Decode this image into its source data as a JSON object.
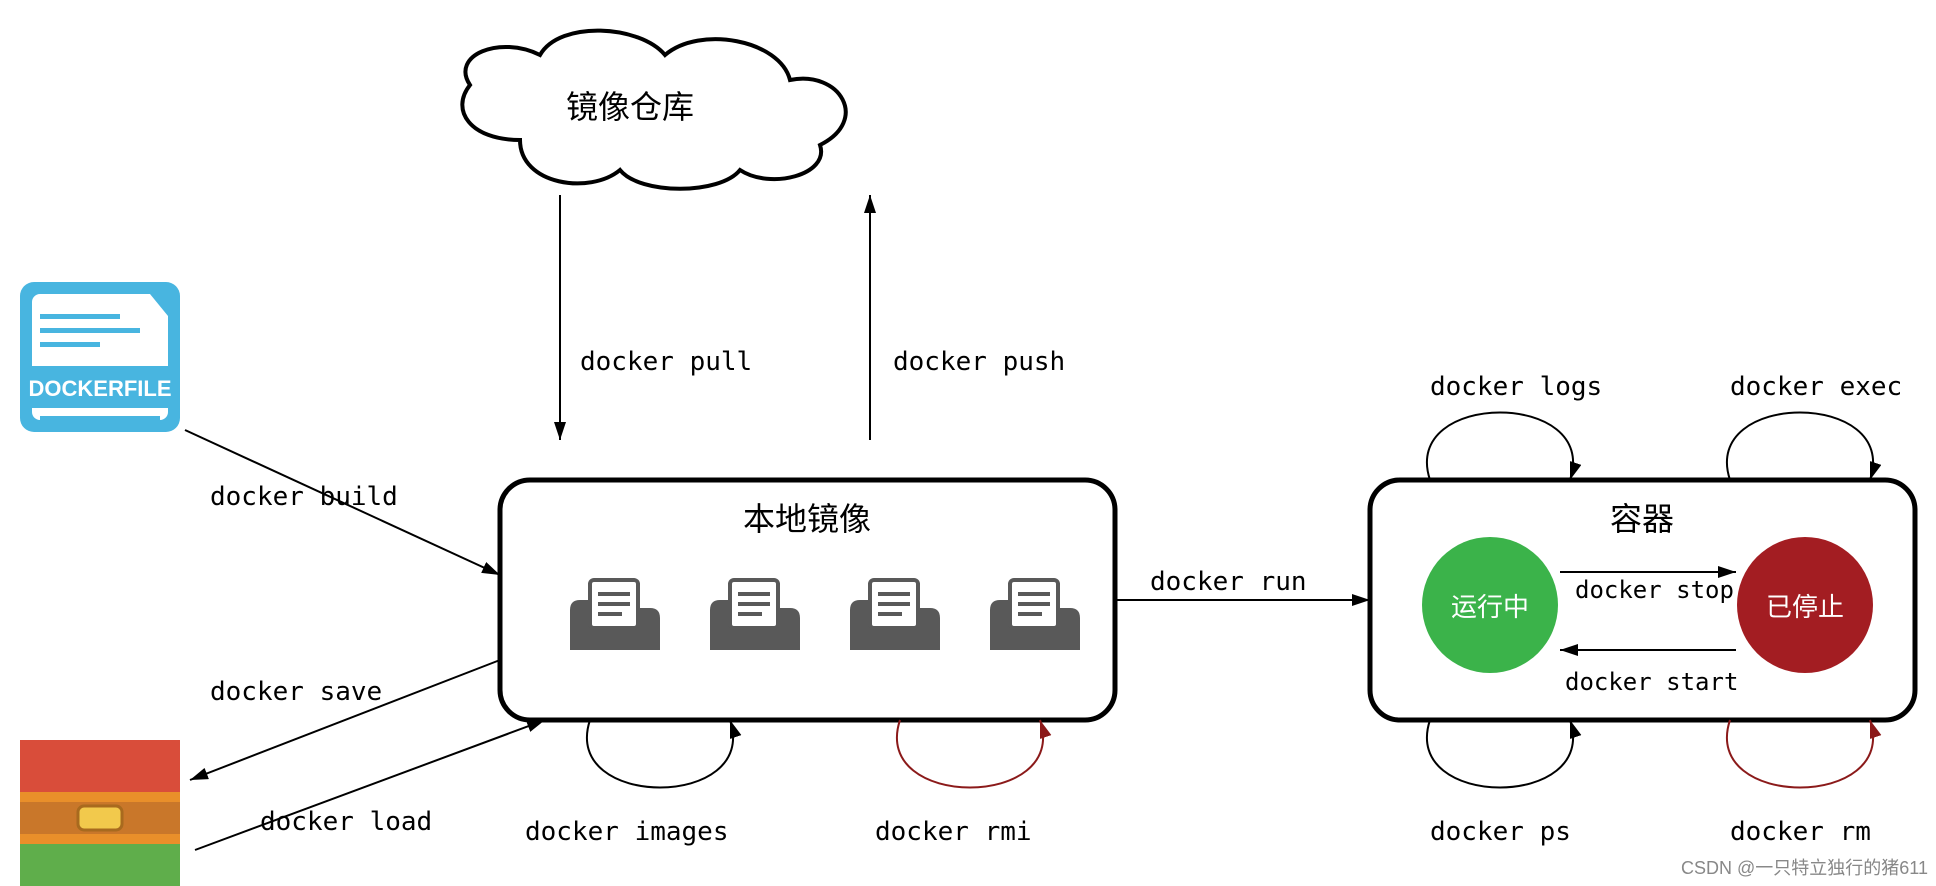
{
  "nodes": {
    "repo": {
      "title": "镜像仓库"
    },
    "local": {
      "title": "本地镜像"
    },
    "container": {
      "title": "容器"
    },
    "dockerfile": {
      "label": "DOCKERFILE"
    },
    "running": {
      "label": "运行中"
    },
    "stopped": {
      "label": "已停止"
    }
  },
  "edges": {
    "pull": {
      "label": "docker pull"
    },
    "push": {
      "label": "docker push"
    },
    "build": {
      "label": "docker build"
    },
    "save": {
      "label": "docker save"
    },
    "load": {
      "label": "docker load"
    },
    "run": {
      "label": "docker run"
    },
    "images": {
      "label": "docker images"
    },
    "rmi": {
      "label": "docker rmi"
    },
    "logs": {
      "label": "docker logs"
    },
    "exec": {
      "label": "docker exec"
    },
    "ps": {
      "label": "docker ps"
    },
    "rm": {
      "label": "docker rm"
    },
    "stop": {
      "label": "docker stop"
    },
    "start": {
      "label": "docker start"
    }
  },
  "watermark": "CSDN @一只特立独行的猪611",
  "colors": {
    "running": "#3bb34a",
    "stopped": "#a31d22",
    "rmi_arc": "#8b1a1a",
    "rm_arc": "#8b1a1a",
    "dockerfile_blue": "#48b5e0",
    "zip_orange": "#e98f2a",
    "zip_red": "#d94d3a",
    "zip_green": "#5fae4b"
  }
}
